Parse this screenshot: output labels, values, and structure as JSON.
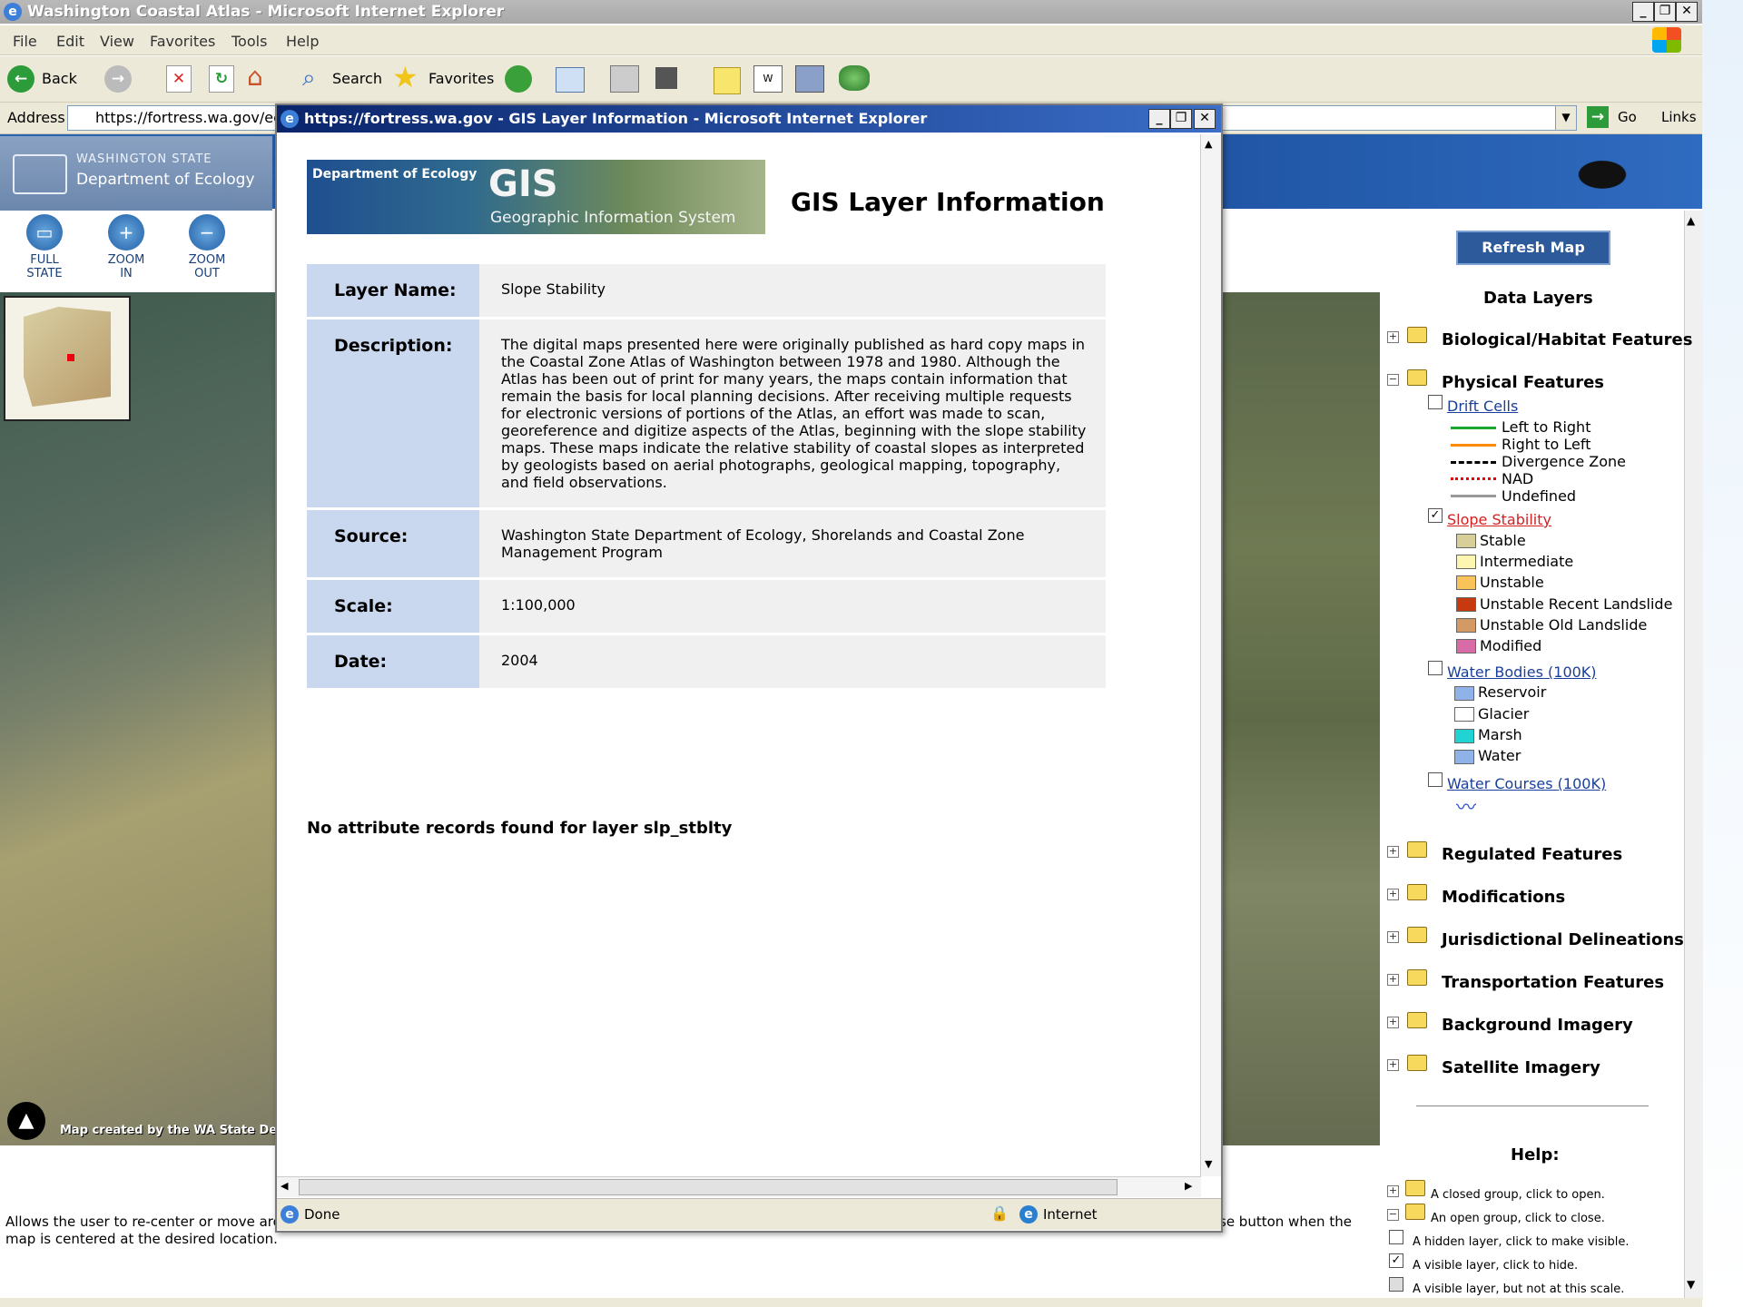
{
  "outer_window": {
    "title": "Washington Coastal Atlas - Microsoft Internet Explorer",
    "menu": [
      "File",
      "Edit",
      "View",
      "Favorites",
      "Tools",
      "Help"
    ],
    "toolbar": {
      "back": "Back",
      "search": "Search",
      "favorites": "Favorites"
    },
    "address_label": "Address",
    "address_value": "https://fortress.wa.gov/ecy",
    "go": "Go",
    "links": "Links"
  },
  "atlas": {
    "agency_line1": "WASHINGTON STATE",
    "agency_line2": "Department of Ecology",
    "tools": [
      {
        "l1": "FULL",
        "l2": "STATE"
      },
      {
        "l1": "ZOOM",
        "l2": "IN"
      },
      {
        "l1": "ZOOM",
        "l2": "OUT"
      }
    ],
    "map_credit": "Map created by the WA State De",
    "status_left": "Allows the user to re-center or move arou",
    "status_left2": "map is centered at the desired location.",
    "status_right": "se button when the",
    "refresh": "Refresh Map",
    "data_layers_title": "Data Layers",
    "groups": {
      "biological": "Biological/Habitat Features",
      "physical": "Physical Features",
      "regulated": "Regulated Features",
      "modifications": "Modifications",
      "jurisdictional": "Jurisdictional Delineations",
      "transportation": "Transportation Features",
      "background": "Background Imagery",
      "satellite": "Satellite Imagery"
    },
    "drift_cells": {
      "label": "Drift Cells",
      "items": [
        "Left to Right",
        "Right to Left",
        "Divergence Zone",
        "NAD",
        "Undefined"
      ]
    },
    "slope_stability": {
      "label": "Slope Stability",
      "items": [
        {
          "name": "Stable",
          "color": "#d7ce9a"
        },
        {
          "name": "Intermediate",
          "color": "#fdf6b0"
        },
        {
          "name": "Unstable",
          "color": "#f8c459"
        },
        {
          "name": "Unstable Recent Landslide",
          "color": "#c73a10"
        },
        {
          "name": "Unstable Old Landslide",
          "color": "#d49a66"
        },
        {
          "name": "Modified",
          "color": "#d86aa6"
        }
      ]
    },
    "water_bodies": {
      "label": "Water Bodies (100K)",
      "items": [
        {
          "name": "Reservoir",
          "color": "#8fb2e8"
        },
        {
          "name": "Glacier",
          "color": "#ffffff"
        },
        {
          "name": "Marsh",
          "color": "#22d3d3"
        },
        {
          "name": "Water",
          "color": "#8fb2e8"
        }
      ]
    },
    "water_courses": {
      "label": "Water Courses (100K)"
    },
    "help": {
      "title": "Help:",
      "rows": [
        "A closed group, click to open.",
        "An open group, click to close.",
        "A hidden layer, click to make visible.",
        "A visible layer, click to hide.",
        "A visible layer, but not at this scale."
      ]
    }
  },
  "popup": {
    "title": "https://fortress.wa.gov - GIS Layer Information - Microsoft Internet Explorer",
    "banner_org": "Department of Ecology",
    "banner_gis": "GIS",
    "banner_sub": "Geographic Information System",
    "heading": "GIS Layer Information",
    "rows": [
      {
        "k": "Layer Name:",
        "v": "Slope Stability"
      },
      {
        "k": "Description:",
        "v": "The digital maps presented here were originally published as hard copy maps in the Coastal Zone Atlas of Washington between 1978 and 1980. Although the Atlas has been out of print for many years, the maps contain information that remain the basis for local planning decisions.  After receiving multiple requests for electronic versions of portions of the Atlas, an effort was made to scan, georeference and digitize aspects of the Atlas, beginning with the slope stability maps.  These maps indicate the relative stability of coastal slopes as interpreted by geologists based on aerial photographs, geological mapping, topography, and field observations."
      },
      {
        "k": "Source:",
        "v": "Washington State Department of Ecology, Shorelands and Coastal Zone Management Program"
      },
      {
        "k": "Scale:",
        "v": "1:100,000"
      },
      {
        "k": "Date:",
        "v": "2004"
      }
    ],
    "no_records": "No attribute records found for layer slp_stblty",
    "status_done": "Done",
    "status_zone": "Internet"
  }
}
